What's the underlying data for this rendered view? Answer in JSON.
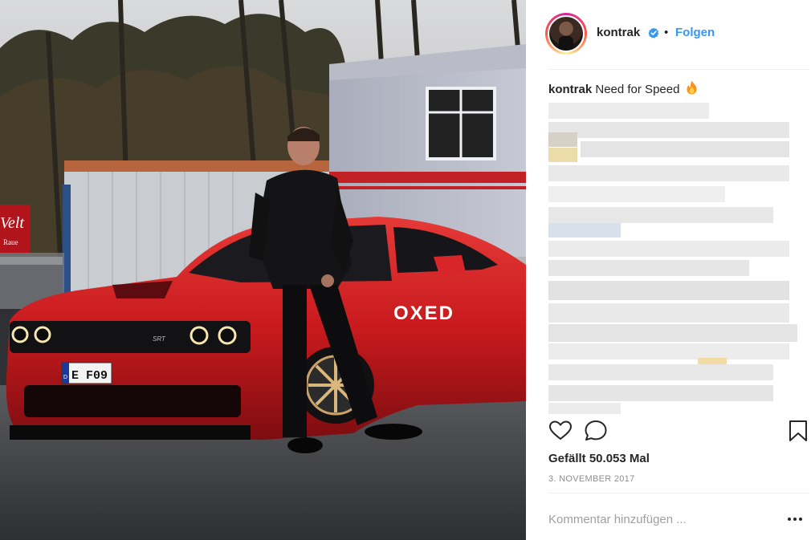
{
  "post": {
    "username": "kontrak",
    "follow_label": "Folgen",
    "separator": "•",
    "caption_user": "kontrak",
    "caption_text": "Need for Speed",
    "likes_text": "Gefällt 50.053 Mal",
    "date_text": "3. NOVEMBER 2017",
    "comment_placeholder": "Kommentar hinzufügen ..."
  },
  "photo": {
    "plate_text": "E F09",
    "plate_country": "D",
    "door_logo": "OXED",
    "grille_badge": "SRT",
    "sign_text": "Velt",
    "sign_subtext": "Raue"
  },
  "icons": {
    "verified": "verified-badge-icon",
    "fire": "fire-emoji-icon",
    "like": "heart-icon",
    "comment": "comment-bubble-icon",
    "save": "bookmark-icon",
    "more": "more-options-icon"
  },
  "colors": {
    "link_blue": "#3897f0",
    "verified_blue": "#3897f0",
    "car_red": "#c81a1e",
    "muted_text": "#8e8e8e"
  }
}
